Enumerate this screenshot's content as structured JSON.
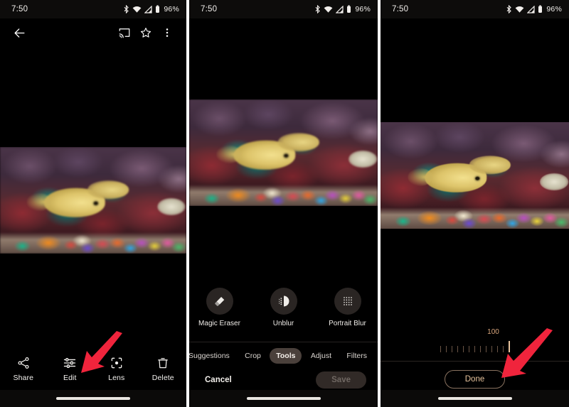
{
  "meta": {
    "accent_red": "#f0243c",
    "accent_tan": "#e7c39c",
    "panel_bg": "#000000"
  },
  "status_bar": {
    "time": "7:50",
    "battery_percent": "96%",
    "icons": [
      "bluetooth-icon",
      "wifi-icon",
      "signal-icon",
      "battery-icon"
    ]
  },
  "panel1": {
    "name": "photo-viewer",
    "appbar": {
      "back": "back-arrow-icon",
      "cast": "cast-icon",
      "favorite": "star-icon",
      "overflow": "more-vert-icon"
    },
    "actions": [
      {
        "label": "Share",
        "icon": "share-icon"
      },
      {
        "label": "Edit",
        "icon": "edit-sliders-icon"
      },
      {
        "label": "Lens",
        "icon": "lens-icon"
      },
      {
        "label": "Delete",
        "icon": "trash-icon"
      }
    ],
    "arrow_target": "Edit"
  },
  "panel2": {
    "name": "photo-editor-tools",
    "tools": [
      {
        "label": "Magic Eraser",
        "icon": "eraser-icon"
      },
      {
        "label": "Unblur",
        "icon": "unblur-icon"
      },
      {
        "label": "Portrait Blur",
        "icon": "portrait-blur-icon"
      }
    ],
    "tabs": [
      {
        "label": "Suggestions",
        "active": false
      },
      {
        "label": "Crop",
        "active": false
      },
      {
        "label": "Tools",
        "active": true
      },
      {
        "label": "Adjust",
        "active": false
      },
      {
        "label": "Filters",
        "active": false
      }
    ],
    "cancel_label": "Cancel",
    "save_label": "Save",
    "arrow_target": "Unblur"
  },
  "panel3": {
    "name": "unblur-strength-slider",
    "slider": {
      "value": "100",
      "tick_count": 13,
      "thumb_index": 12
    },
    "done_label": "Done",
    "arrow_target": "Done"
  }
}
